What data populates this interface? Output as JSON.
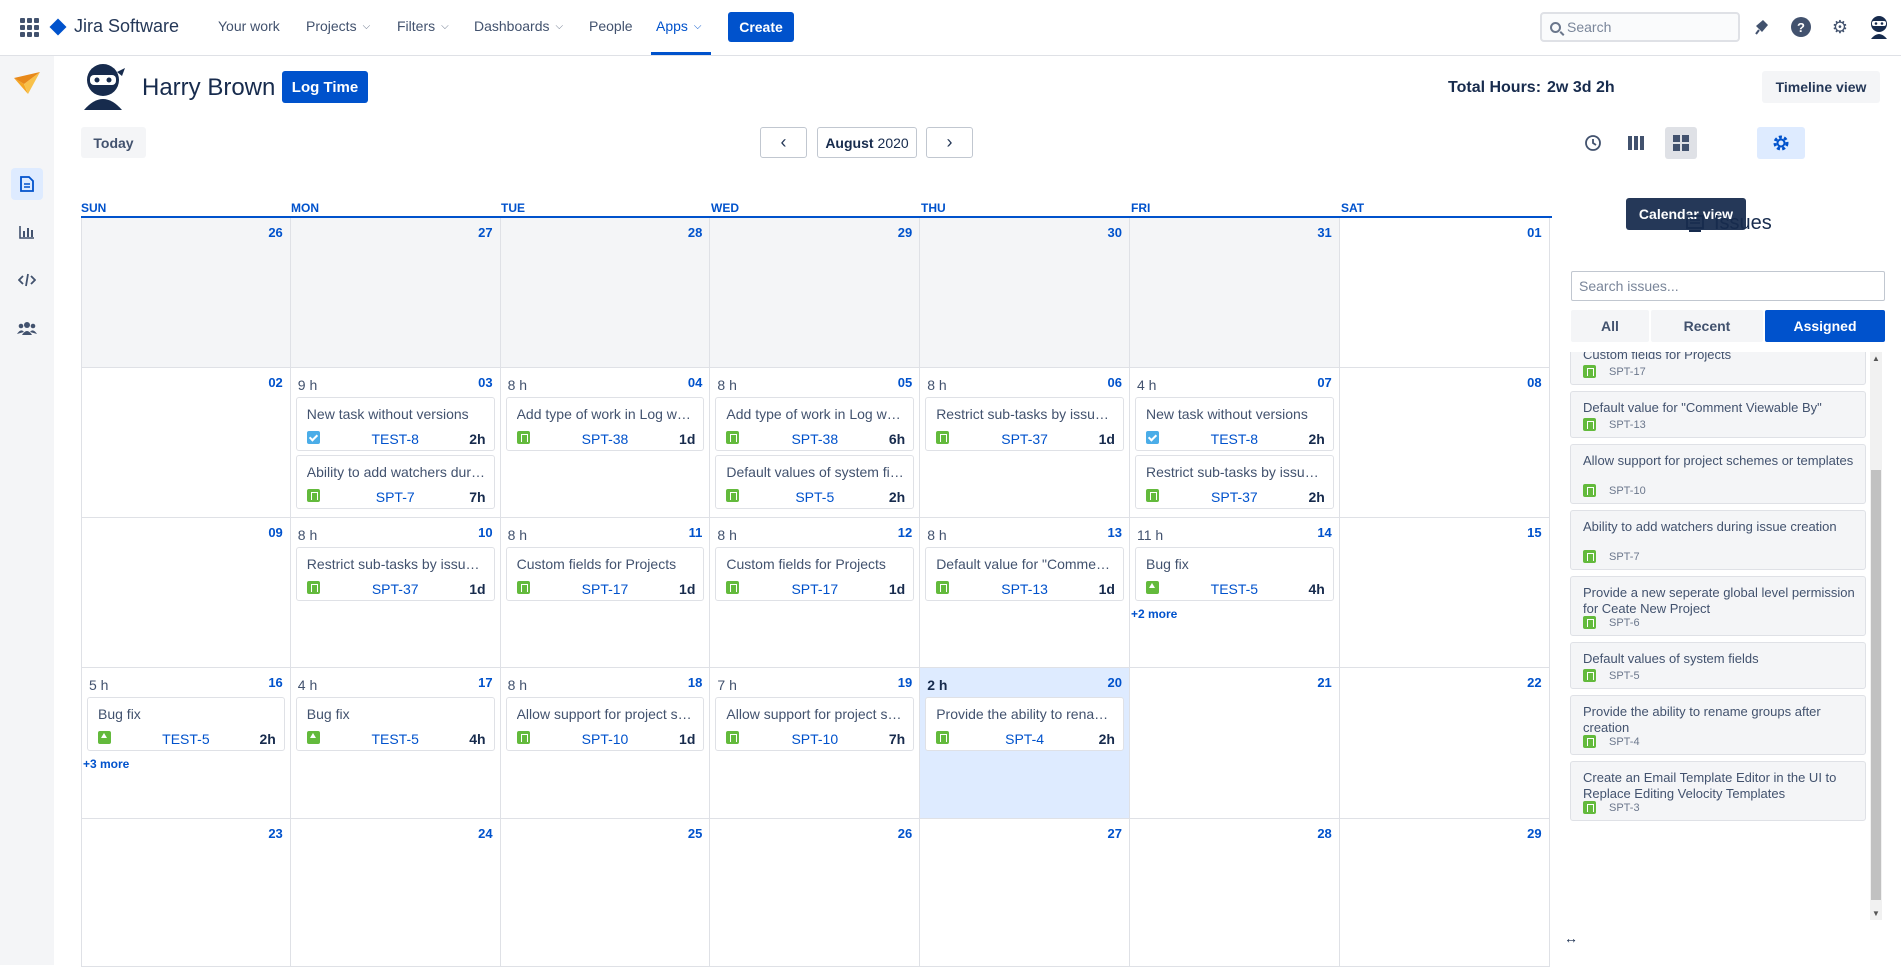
{
  "nav": {
    "app_name": "Jira Software",
    "items": [
      "Your work",
      "Projects",
      "Filters",
      "Dashboards",
      "People",
      "Apps"
    ],
    "create_label": "Create",
    "search_placeholder": "Search"
  },
  "header": {
    "user_name": "Harry Brown",
    "log_time_label": "Log Time",
    "total_hours_label": "Total Hours:",
    "total_hours_value": "2w 3d 2h",
    "calendar_view_label": "Calendar view",
    "timeline_view_label": "Timeline view"
  },
  "toolbar": {
    "today_label": "Today",
    "month": "August",
    "year": "2020"
  },
  "calendar": {
    "days_of_week": [
      "SUN",
      "MON",
      "TUE",
      "WED",
      "THU",
      "FRI",
      "SAT"
    ],
    "weeks": [
      [
        {
          "day": "26",
          "prev": true
        },
        {
          "day": "27",
          "prev": true
        },
        {
          "day": "28",
          "prev": true
        },
        {
          "day": "29",
          "prev": true
        },
        {
          "day": "30",
          "prev": true
        },
        {
          "day": "31",
          "prev": true
        },
        {
          "day": "01"
        }
      ],
      [
        {
          "day": "02"
        },
        {
          "day": "03",
          "hours": "9 h",
          "cards": [
            {
              "title": "New task without versions",
              "key": "TEST-8",
              "time": "2h",
              "type": "task"
            },
            {
              "title": "Ability to add watchers during issue creation",
              "key": "SPT-7",
              "time": "7h",
              "type": "story"
            }
          ]
        },
        {
          "day": "04",
          "hours": "8 h",
          "cards": [
            {
              "title": "Add type of work in Log work dialog",
              "key": "SPT-38",
              "time": "1d",
              "type": "story"
            }
          ]
        },
        {
          "day": "05",
          "hours": "8 h",
          "cards": [
            {
              "title": "Add type of work in Log work dialog",
              "key": "SPT-38",
              "time": "6h",
              "type": "story"
            },
            {
              "title": "Default values of system fields",
              "key": "SPT-5",
              "time": "2h",
              "type": "story"
            }
          ]
        },
        {
          "day": "06",
          "hours": "8 h",
          "cards": [
            {
              "title": "Restrict sub-tasks by issue type",
              "key": "SPT-37",
              "time": "1d",
              "type": "story"
            }
          ]
        },
        {
          "day": "07",
          "hours": "4 h",
          "cards": [
            {
              "title": "New task without versions",
              "key": "TEST-8",
              "time": "2h",
              "type": "task"
            },
            {
              "title": "Restrict sub-tasks by issue type",
              "key": "SPT-37",
              "time": "2h",
              "type": "story"
            }
          ]
        },
        {
          "day": "08"
        }
      ],
      [
        {
          "day": "09"
        },
        {
          "day": "10",
          "hours": "8 h",
          "cards": [
            {
              "title": "Restrict sub-tasks by issue type",
              "key": "SPT-37",
              "time": "1d",
              "type": "story"
            }
          ]
        },
        {
          "day": "11",
          "hours": "8 h",
          "cards": [
            {
              "title": "Custom fields for Projects",
              "key": "SPT-17",
              "time": "1d",
              "type": "story"
            }
          ]
        },
        {
          "day": "12",
          "hours": "8 h",
          "cards": [
            {
              "title": "Custom fields for Projects",
              "key": "SPT-17",
              "time": "1d",
              "type": "story"
            }
          ]
        },
        {
          "day": "13",
          "hours": "8 h",
          "cards": [
            {
              "title": "Default value for \"Comment Viewable By\"",
              "key": "SPT-13",
              "time": "1d",
              "type": "story"
            }
          ]
        },
        {
          "day": "14",
          "hours": "11 h",
          "cards": [
            {
              "title": "Bug fix",
              "key": "TEST-5",
              "time": "4h",
              "type": "improve"
            }
          ],
          "more": "+2 more"
        },
        {
          "day": "15"
        }
      ],
      [
        {
          "day": "16",
          "hours": "5 h",
          "cards": [
            {
              "title": "Bug fix",
              "key": "TEST-5",
              "time": "2h",
              "type": "improve"
            }
          ],
          "more": "+3 more"
        },
        {
          "day": "17",
          "hours": "4 h",
          "cards": [
            {
              "title": "Bug fix",
              "key": "TEST-5",
              "time": "4h",
              "type": "improve"
            }
          ]
        },
        {
          "day": "18",
          "hours": "8 h",
          "cards": [
            {
              "title": "Allow support for project schemes or templates",
              "key": "SPT-10",
              "time": "1d",
              "type": "story"
            }
          ]
        },
        {
          "day": "19",
          "hours": "7 h",
          "cards": [
            {
              "title": "Allow support for project schemes or templates",
              "key": "SPT-10",
              "time": "7h",
              "type": "story"
            }
          ]
        },
        {
          "day": "20",
          "hours": "2 h",
          "today": true,
          "cards": [
            {
              "title": "Provide the ability to rename groups after creation",
              "key": "SPT-4",
              "time": "2h",
              "type": "story"
            }
          ]
        },
        {
          "day": "21"
        },
        {
          "day": "22"
        }
      ],
      [
        {
          "day": "23"
        },
        {
          "day": "24"
        },
        {
          "day": "25"
        },
        {
          "day": "26"
        },
        {
          "day": "27"
        },
        {
          "day": "28"
        },
        {
          "day": "29"
        }
      ]
    ]
  },
  "issues_panel": {
    "title": "Issues",
    "search_placeholder": "Search issues...",
    "tabs": [
      "All",
      "Recent",
      "Assigned"
    ],
    "active_tab": "Assigned",
    "items": [
      {
        "summary": "Custom fields for Projects",
        "key": "SPT-17"
      },
      {
        "summary": "Default value for \"Comment Viewable By\"",
        "key": "SPT-13"
      },
      {
        "summary": "Allow support for project schemes or templates",
        "key": "SPT-10"
      },
      {
        "summary": "Ability to add watchers during issue creation",
        "key": "SPT-7"
      },
      {
        "summary": "Provide a new seperate global level permission for Ceate New Project",
        "key": "SPT-6"
      },
      {
        "summary": "Default values of system fields",
        "key": "SPT-5"
      },
      {
        "summary": "Provide the ability to rename groups after creation",
        "key": "SPT-4"
      },
      {
        "summary": "Create an Email Template Editor in the UI to Replace Editing Velocity Templates",
        "key": "SPT-3"
      }
    ]
  },
  "colors": {
    "accent": "#0052cc",
    "today_bg": "#deebff",
    "story_icon": "#63ba3c",
    "task_icon": "#4bade8"
  }
}
